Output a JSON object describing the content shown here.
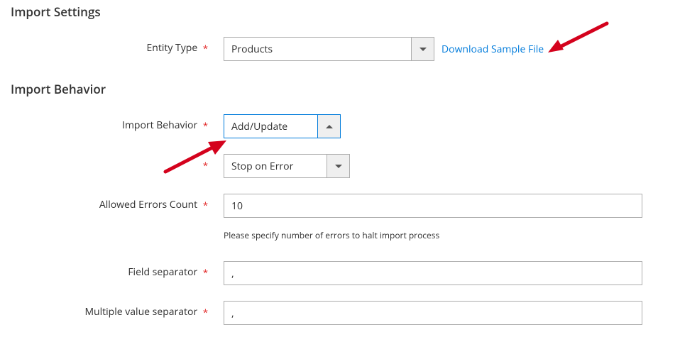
{
  "sections": {
    "import_settings": {
      "title": "Import Settings",
      "entity_type": {
        "label": "Entity Type",
        "value": "Products",
        "download_link": "Download Sample File"
      }
    },
    "import_behavior": {
      "title": "Import Behavior",
      "behavior": {
        "label": "Import Behavior",
        "value": "Add/Update"
      },
      "on_error": {
        "label": "",
        "value": "Stop on Error"
      },
      "allowed_errors": {
        "label": "Allowed Errors Count",
        "value": "10",
        "helper": "Please specify number of errors to halt import process"
      },
      "field_separator": {
        "label": "Field separator",
        "value": ","
      },
      "multi_separator": {
        "label": "Multiple value separator",
        "value": ","
      }
    }
  },
  "colors": {
    "link": "#007bdb",
    "required": "#e22626",
    "arrow": "#d4021d"
  }
}
